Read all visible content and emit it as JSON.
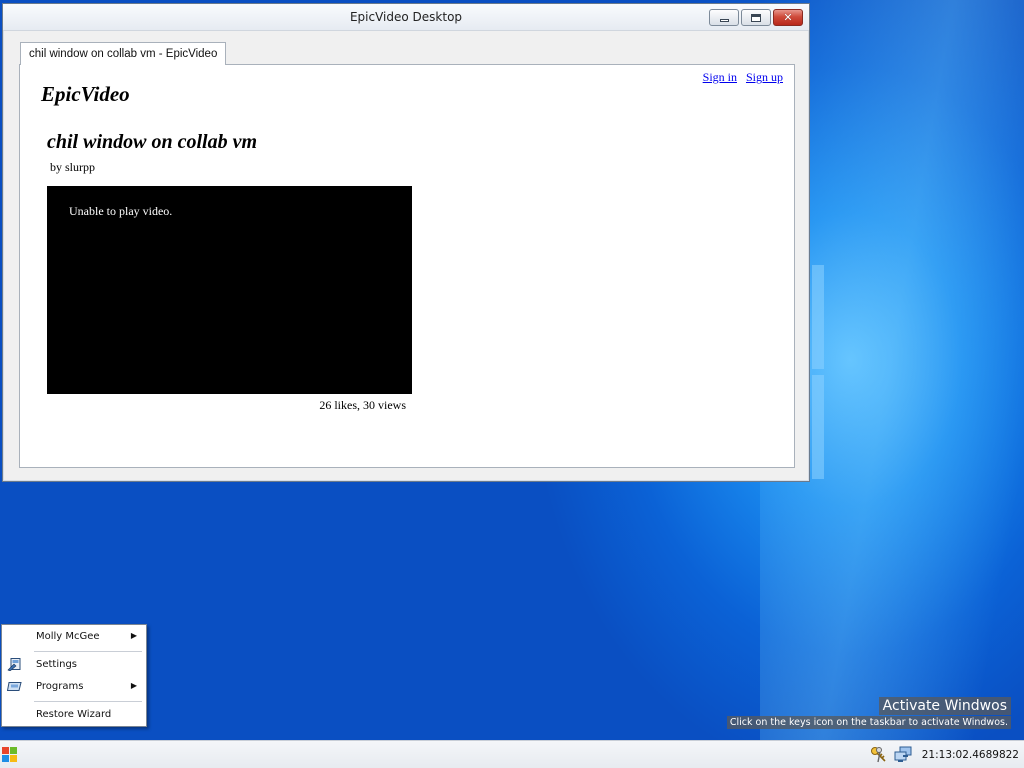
{
  "window": {
    "title": "EpicVideo Desktop",
    "tab_label": "chil window on collab vm - EpicVideo",
    "close_glyph": "✕"
  },
  "page": {
    "sign_in": "Sign in",
    "sign_up": "Sign up",
    "brand": "EpicVideo",
    "video_title": "chil window on collab vm",
    "byline": "by slurpp",
    "player_message": "Unable to play video.",
    "stats": "26 likes, 30 views"
  },
  "start_menu": {
    "items": [
      {
        "label": "Molly McGee",
        "has_submenu": true,
        "icon": null
      },
      {
        "label": "Settings",
        "has_submenu": false,
        "icon": "settings-icon"
      },
      {
        "label": "Programs",
        "has_submenu": true,
        "icon": "programs-icon"
      },
      {
        "label": "Restore Wizard",
        "has_submenu": false,
        "icon": null
      }
    ],
    "submenu_arrow": "▶"
  },
  "watermark": {
    "title": "Activate Windwos",
    "subtitle": "Click on the keys icon on the taskbar to activate Windwos."
  },
  "taskbar": {
    "clock": "21:13:02.4689822",
    "tray_icons": [
      "keys-icon",
      "network-icon"
    ]
  },
  "colors": {
    "desktop_blue": "#0b62d6",
    "link": "#0000ee",
    "close_red": "#cf4b3b"
  }
}
